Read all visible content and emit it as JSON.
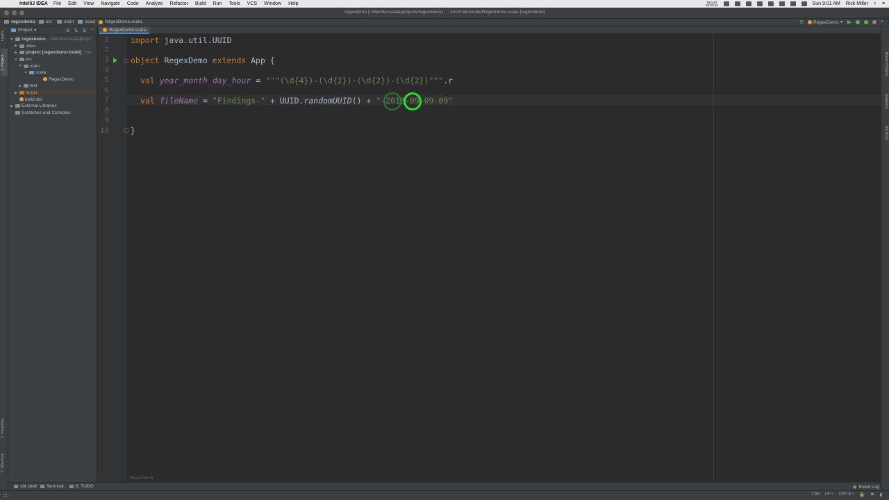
{
  "menubar": {
    "app_name": "IntelliJ IDEA",
    "items": [
      "File",
      "Edit",
      "View",
      "Navigate",
      "Code",
      "Analyze",
      "Refactor",
      "Build",
      "Run",
      "Tools",
      "VCS",
      "Window",
      "Help"
    ],
    "recording_label": "Record",
    "recording_time": "00:03:44",
    "clock": "Sun 9:01 AM",
    "user": "Rick Miller"
  },
  "window": {
    "title": "regexdemo [~/dev/dev.scala/projects/regexdemo] - .../src/main/scala/RegexDemo.scala [regexdemo]"
  },
  "navbar": {
    "crumbs": [
      "regexdemo",
      "src",
      "main",
      "scala",
      "RegexDemo.scala"
    ],
    "run_config": "RegexDemo"
  },
  "project_panel": {
    "title": "Project",
    "tree": [
      {
        "label": "regexdemo",
        "extra": "~/dev/dev.scala/proje",
        "arrow": "▼",
        "icon": "folder"
      },
      {
        "label": ".idea",
        "arrow": "▶",
        "icon": "folder"
      },
      {
        "label": "project [regexdemo-build]",
        "extra": "sou",
        "arrow": "▶",
        "icon": "folder"
      },
      {
        "label": "src",
        "arrow": "▼",
        "icon": "folder"
      },
      {
        "label": "main",
        "arrow": "▼",
        "icon": "folder"
      },
      {
        "label": "scala",
        "arrow": "▼",
        "icon": "folder-blue"
      },
      {
        "label": "RegexDemo",
        "arrow": "",
        "icon": "file"
      },
      {
        "label": "test",
        "arrow": "▶",
        "icon": "folder"
      },
      {
        "label": "target",
        "arrow": "▶",
        "icon": "folder-orange"
      },
      {
        "label": "build.sbt",
        "arrow": "",
        "icon": "sbt"
      },
      {
        "label": "External Libraries",
        "arrow": "▶",
        "icon": "lib"
      },
      {
        "label": "Scratches and Consoles",
        "arrow": "",
        "icon": "scratch"
      }
    ]
  },
  "left_stripe": {
    "tabs": [
      "1: Project",
      "Learn",
      "2: Favorites",
      "7: Structure"
    ]
  },
  "right_stripe": {
    "tabs": [
      "Maven Projects",
      "Database",
      "Ant Build"
    ]
  },
  "editor": {
    "tab_label": "RegexDemo.scala",
    "line_numbers": [
      "1",
      "2",
      "3",
      "4",
      "5",
      "6",
      "7",
      "8",
      "9",
      "10"
    ],
    "line1": {
      "kw": "import",
      "rest": " java.util.UUID"
    },
    "line3": {
      "kw1": "object",
      "name": " RegexDemo ",
      "kw2": "extends",
      "rest": " App {"
    },
    "line5": {
      "kw": "val",
      "field": "year_month_day_hour",
      "eq": " = ",
      "str": "\"\"\"(\\d{4})-(\\d{2})-(\\d{2})-(\\d{2})\"\"\"",
      "rest": ".r"
    },
    "line7": {
      "kw": "val",
      "field": "fileName",
      "eq": " = ",
      "str1": "\"Findings-\"",
      "op": " + UUID.",
      "method": "randomUUID",
      "rest": "() + ",
      "str2": "\"-2018-09-09-09\""
    },
    "line10": {
      "text": "}"
    },
    "breadcrumb": "RegexDemo"
  },
  "bottom_tools": {
    "items": [
      "sbt shell",
      "Terminal",
      "6: TODO"
    ],
    "event_log": "Event Log"
  },
  "statusbar": {
    "position": "7:58",
    "line_sep": "LF ÷",
    "encoding": "UTF-8 ÷"
  },
  "colors": {
    "keyword": "#cc7832",
    "field": "#9876aa",
    "string": "#6a8759",
    "cursor_ring": "#2fdc2f"
  }
}
